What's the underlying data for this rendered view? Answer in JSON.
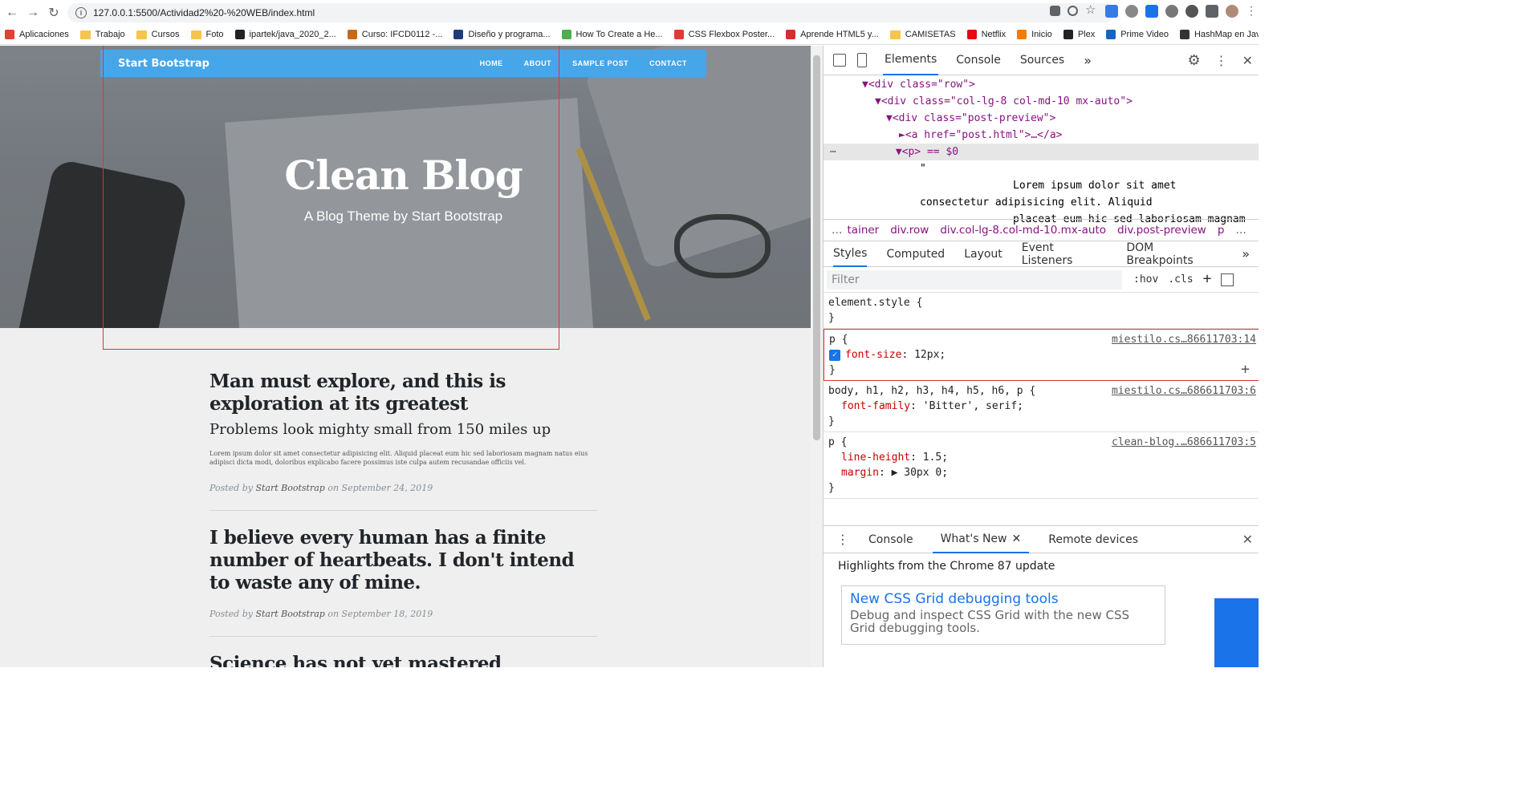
{
  "browser": {
    "url": "127.0.0.1:5500/Actividad2%20-%20WEB/index.html",
    "bookmarks": [
      {
        "label": "Aplicaciones",
        "icon": "apps-grid-icon",
        "color": "#e34133"
      },
      {
        "label": "Trabajo",
        "icon": "folder-icon",
        "color": "#f6c54b"
      },
      {
        "label": "Cursos",
        "icon": "folder-icon",
        "color": "#f6c54b"
      },
      {
        "label": "Foto",
        "icon": "folder-icon",
        "color": "#f6c54b"
      },
      {
        "label": "ipartek/java_2020_2...",
        "icon": "github-icon",
        "color": "#222222"
      },
      {
        "label": "Curso: IFCD0112 -...",
        "icon": "site-icon",
        "color": "#c46a1f"
      },
      {
        "label": "Diseño y programa...",
        "icon": "site-icon",
        "color": "#1c3c7a"
      },
      {
        "label": "How To Create a He...",
        "icon": "site-icon",
        "color": "#4caf50"
      },
      {
        "label": "CSS Flexbox Poster...",
        "icon": "site-icon",
        "color": "#e53935"
      },
      {
        "label": "Aprende HTML5 y...",
        "icon": "site-icon",
        "color": "#d32f2f"
      },
      {
        "label": "CAMISETAS",
        "icon": "folder-icon",
        "color": "#f6c54b"
      },
      {
        "label": "Netflix",
        "icon": "netflix-icon",
        "color": "#e50914"
      },
      {
        "label": "Inicio",
        "icon": "site-icon",
        "color": "#f57c00"
      },
      {
        "label": "Plex",
        "icon": "plex-icon",
        "color": "#222222"
      },
      {
        "label": "Prime Video",
        "icon": "prime-icon",
        "color": "#1565c0"
      },
      {
        "label": "HashMap en Java -...",
        "icon": "site-icon",
        "color": "#333333"
      }
    ]
  },
  "site": {
    "brand": "Start Bootstrap",
    "nav": [
      "HOME",
      "ABOUT",
      "SAMPLE POST",
      "CONTACT"
    ],
    "hero_title": "Clean Blog",
    "hero_subtitle": "A Blog Theme by Start Bootstrap",
    "posts": [
      {
        "title": "Man must explore, and this is exploration at its greatest",
        "subtitle": "Problems look mighty small from 150 miles up",
        "excerpt": "Lorem ipsum dolor sit amet consectetur adipisicing elit. Aliquid placeat eum hic sed laboriosam magnam natus eius adipisci dicta modi, doloribus explicabo facere possimus iste culpa autem recusandae officiis vel.",
        "meta_prefix": "Posted by",
        "author": "Start Bootstrap",
        "meta_on": "on September 24, 2019"
      },
      {
        "title": "I believe every human has a finite number of heartbeats. I don't intend to waste any of mine.",
        "meta_prefix": "Posted by",
        "author": "Start Bootstrap",
        "meta_on": "on September 18, 2019"
      },
      {
        "title": "Science has not yet mastered prophecy"
      }
    ]
  },
  "devtools": {
    "tabs": [
      "Elements",
      "Console",
      "Sources"
    ],
    "code_lines": [
      "▼<div class=\"row\">",
      "▼<div class=\"col-lg-8 col-md-10 mx-auto\">",
      "▼<div class=\"post-preview\">",
      "►<a href=\"post.html\">…</a>",
      "▼<p> == $0",
      "\"",
      "Lorem ipsum dolor sit amet",
      "consectetur adipisicing elit. Aliquid",
      "placeat eum hic sed laboriosam magnam"
    ],
    "crumbs": [
      "…",
      "tainer",
      "div.row",
      "div.col-lg-8.col-md-10.mx-auto",
      "div.post-preview",
      "p",
      "…"
    ],
    "subtabs": [
      "Styles",
      "Computed",
      "Layout",
      "Event Listeners",
      "DOM Breakpoints"
    ],
    "filter_placeholder": "Filter",
    "filter_hov": ":hov",
    "filter_cls": ".cls",
    "rules": [
      {
        "selector": "element.style {",
        "props": [],
        "close": "}",
        "src": ""
      },
      {
        "selector": "p {",
        "props": [
          {
            "name": "font-size",
            "value": "12px;"
          }
        ],
        "close": "}",
        "src": "miestilo.cs…86611703:14"
      },
      {
        "selector": "body, h1, h2, h3, h4, h5, h6, p {",
        "props": [
          {
            "name": "font-family",
            "value": "'Bitter', serif;"
          }
        ],
        "close": "}",
        "src": "miestilo.cs…686611703:6"
      },
      {
        "selector": "p {",
        "props": [
          {
            "name": "line-height",
            "value": "1.5;"
          },
          {
            "name": "margin",
            "value": "▶ 30px 0;"
          }
        ],
        "close": "}",
        "src": "clean-blog.…686611703:5"
      }
    ],
    "drawer_tabs": [
      "Console",
      "What's New",
      "Remote devices"
    ],
    "drawer_heading": "Highlights from the Chrome 87 update",
    "card_title": "New CSS Grid debugging tools",
    "card_desc": "Debug and inspect CSS Grid with the new CSS Grid debugging tools."
  }
}
